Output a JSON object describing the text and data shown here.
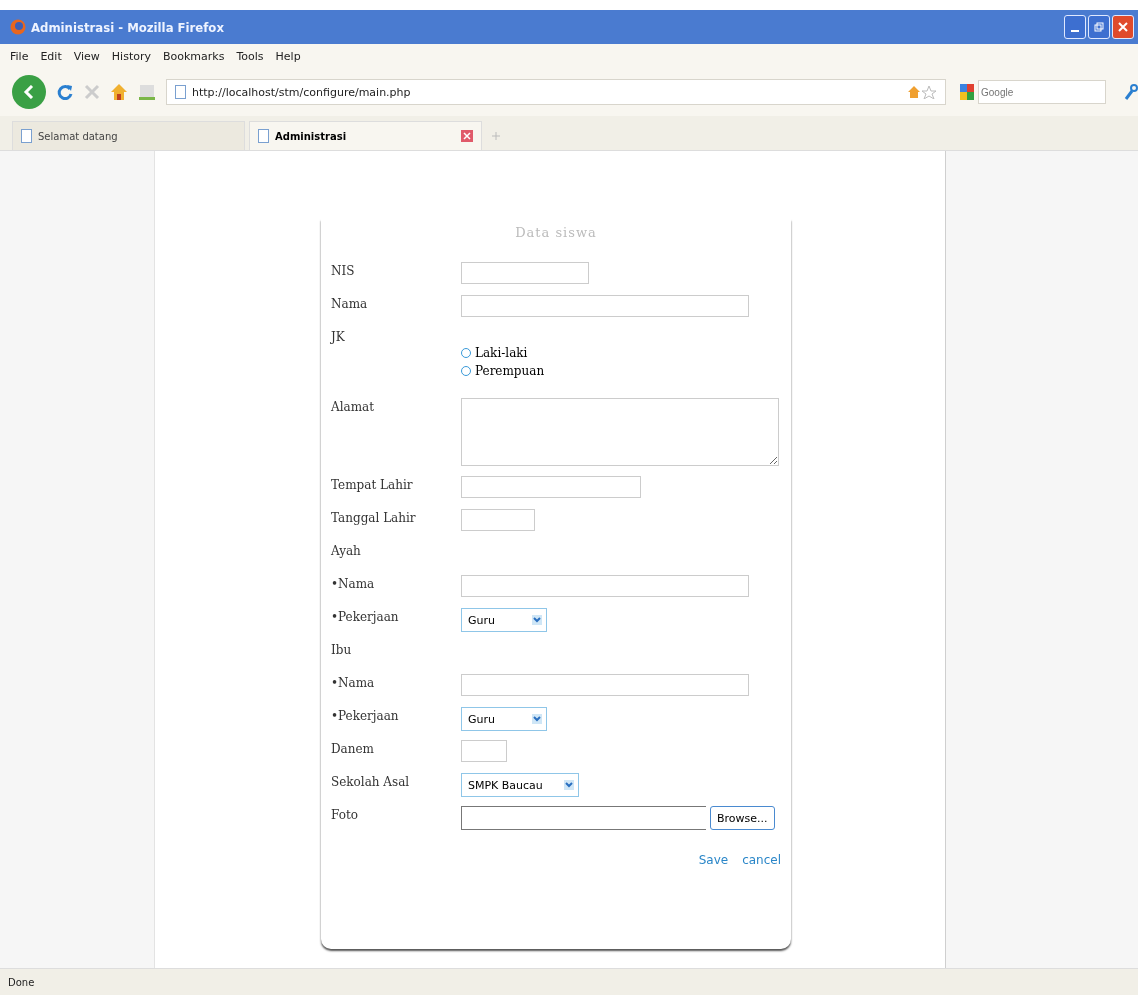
{
  "window": {
    "title": "Administrasi - Mozilla Firefox"
  },
  "menu": [
    "File",
    "Edit",
    "View",
    "History",
    "Bookmarks",
    "Tools",
    "Help"
  ],
  "address": {
    "value": "http://localhost/stm/configure/main.php"
  },
  "search": {
    "placeholder": "Google"
  },
  "tabs": [
    {
      "label": "Selamat datang",
      "selected": false
    },
    {
      "label": "Administrasi",
      "selected": true
    }
  ],
  "form": {
    "title": "Data siswa",
    "rows": [
      {
        "kind": "text",
        "label": "NIS"
      },
      {
        "kind": "text",
        "label": "Nama"
      },
      {
        "kind": "radio",
        "label": "JK",
        "options": [
          {
            "label": "Laki-laki",
            "selected": false
          },
          {
            "label": "Perempuan",
            "selected": false
          }
        ]
      },
      {
        "kind": "textarea",
        "label": "Alamat"
      },
      {
        "kind": "text",
        "label": "Tempat Lahir"
      },
      {
        "kind": "text",
        "label": "Tanggal Lahir"
      },
      {
        "kind": "heading",
        "label": "Ayah"
      },
      {
        "kind": "text",
        "label": "•Nama"
      },
      {
        "kind": "select",
        "label": "•Pekerjaan",
        "value": "Guru"
      },
      {
        "kind": "heading",
        "label": "Ibu"
      },
      {
        "kind": "text",
        "label": "•Nama"
      },
      {
        "kind": "select",
        "label": "•Pekerjaan",
        "value": "Guru"
      },
      {
        "kind": "text",
        "label": "Danem"
      },
      {
        "kind": "select",
        "label": "Sekolah Asal",
        "value": "SMPK Baucau"
      },
      {
        "kind": "file",
        "label": "Foto",
        "button": "Browse..."
      }
    ],
    "actions": [
      "Save",
      "cancel"
    ]
  },
  "status_bar": "Done"
}
